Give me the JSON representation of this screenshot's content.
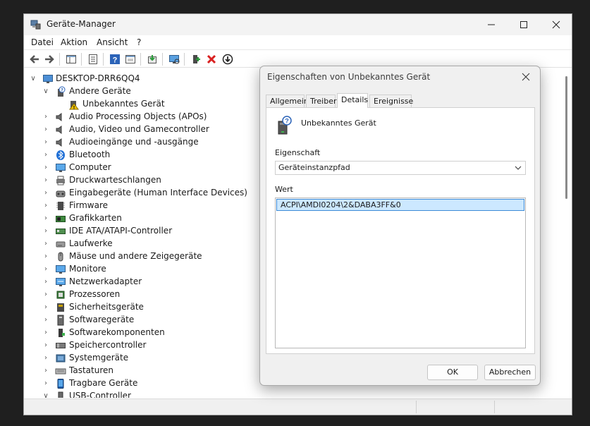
{
  "window": {
    "title": "Geräte-Manager",
    "menu": [
      "Datei",
      "Aktion",
      "Ansicht",
      "?"
    ]
  },
  "tree": {
    "root": "DESKTOP-DRR6QQ4",
    "items": [
      {
        "label": "Andere Geräte",
        "expanded": true,
        "icon": "unknown-device-icon"
      },
      {
        "label": "Unbekanntes Gerät",
        "child": true,
        "icon": "warning-device-icon"
      },
      {
        "label": "Audio Processing Objects (APOs)",
        "icon": "speaker-icon"
      },
      {
        "label": "Audio, Video und Gamecontroller",
        "icon": "speaker-icon"
      },
      {
        "label": "Audioeingänge und -ausgänge",
        "icon": "speaker-icon"
      },
      {
        "label": "Bluetooth",
        "icon": "bluetooth-icon"
      },
      {
        "label": "Computer",
        "icon": "monitor-icon"
      },
      {
        "label": "Druckwarteschlangen",
        "icon": "printer-icon"
      },
      {
        "label": "Eingabegeräte (Human Interface Devices)",
        "icon": "hid-icon"
      },
      {
        "label": "Firmware",
        "icon": "firmware-icon"
      },
      {
        "label": "Grafikkarten",
        "icon": "graphics-card-icon"
      },
      {
        "label": "IDE ATA/ATAPI-Controller",
        "icon": "controller-icon"
      },
      {
        "label": "Laufwerke",
        "icon": "drive-icon"
      },
      {
        "label": "Mäuse und andere Zeigegeräte",
        "icon": "mouse-icon"
      },
      {
        "label": "Monitore",
        "icon": "monitor-icon"
      },
      {
        "label": "Netzwerkadapter",
        "icon": "network-adapter-icon"
      },
      {
        "label": "Prozessoren",
        "icon": "processor-icon"
      },
      {
        "label": "Sicherheitsgeräte",
        "icon": "security-device-icon"
      },
      {
        "label": "Softwaregeräte",
        "icon": "software-device-icon"
      },
      {
        "label": "Softwarekomponenten",
        "icon": "software-component-icon"
      },
      {
        "label": "Speichercontroller",
        "icon": "storage-controller-icon"
      },
      {
        "label": "Systemgeräte",
        "icon": "system-device-icon"
      },
      {
        "label": "Tastaturen",
        "icon": "keyboard-icon"
      },
      {
        "label": "Tragbare Geräte",
        "icon": "portable-device-icon"
      },
      {
        "label": "USB-Controller",
        "expanded": true,
        "icon": "usb-icon"
      }
    ]
  },
  "dialog": {
    "title": "Eigenschaften von Unbekanntes Gerät",
    "tabs": [
      "Allgemein",
      "Treiber",
      "Details",
      "Ereignisse"
    ],
    "active_tab": "Details",
    "device_name": "Unbekanntes Gerät",
    "property_label": "Eigenschaft",
    "property_value": "Geräteinstanzpfad",
    "value_label": "Wert",
    "value": "ACPI\\AMDI0204\\2&DABA3FF&0",
    "ok": "OK",
    "cancel": "Abbrechen"
  },
  "colors": {
    "accent": "#0067c0",
    "selection": "#cce8ff",
    "delete_red": "#d92020"
  }
}
